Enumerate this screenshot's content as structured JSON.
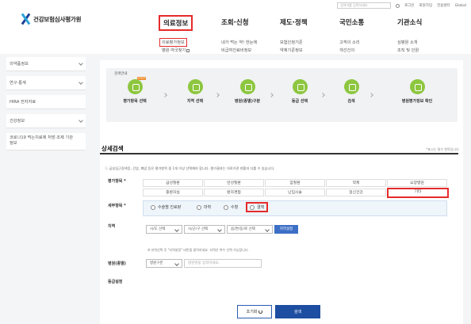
{
  "header": {
    "logo_text": "건강보험심사평가원",
    "search_placeholder": "검색어를 입력하세요.",
    "util_links": [
      "로그인",
      "회원가입",
      "전용센터",
      "Global"
    ],
    "gnb": [
      "의료정보",
      "조회·신청",
      "제도·정책",
      "국민소통",
      "기관소식"
    ],
    "sub_menu": {
      "col1": [
        "의료평가정보",
        "병원·약국찾기"
      ],
      "col2": [
        "내가 먹는 약! 한눈에",
        "비급여진료비정보"
      ],
      "col3": [
        "보험인정기준",
        "약제기준정보"
      ],
      "col4": [
        "고객의 소리",
        "개선건의"
      ],
      "col5": [
        "심평원 소개",
        "조직 및 인원"
      ]
    }
  },
  "lnb": [
    "의약품정보",
    "연구·통계",
    "HIRA 전자자료",
    "건강정보",
    "코로나19 먹는치료제 처방·조제 기관 정보"
  ],
  "steps": {
    "title": "검색안내",
    "items": [
      "평가항목 선택",
      "지역 선택",
      "병원(종별)구분",
      "등급 선택",
      "검색",
      "병원평가정보 확인"
    ],
    "badge": "STEP"
  },
  "search": {
    "title": "상세검색",
    "required_note": "*표시는 필수 항목입니다.",
    "notice": "ⓘ 급성심근경색증, 간암, 폐암 등은 평가항목 중 1개 이상 선택해야 합니다. 평가결과는 의료기관 현황과 다를 수 있습니다.",
    "eval_label": "평가항목 *",
    "eval_row1": [
      "급성질환",
      "만성질환",
      "암질환",
      "약제",
      "요양병원"
    ],
    "eval_row2": [
      "중환자실",
      "환자경험",
      "난임시술",
      "정신건강",
      "기타"
    ],
    "detail_label": "세부항목 *",
    "detail_options": [
      "수술별 진료량",
      "마취",
      "수혈",
      "결핵"
    ],
    "region_label": "지역",
    "region_selects": [
      "시/도 선택",
      "시/군/구 선택",
      "읍/면/동/로 선택"
    ],
    "region_button": "지역설정",
    "region_note": "※ 지역선택 후 \"지역설정\" 버튼을 클릭하세요. 지역은 복수 선택 가능합니다.",
    "hospital_label": "병원(종별)",
    "hospital_select": "병원구분",
    "hospital_placeholder": "병원명을 입력하세요.",
    "grade_label": "등급설정",
    "reset_button": "초기화",
    "search_button": "검색"
  }
}
